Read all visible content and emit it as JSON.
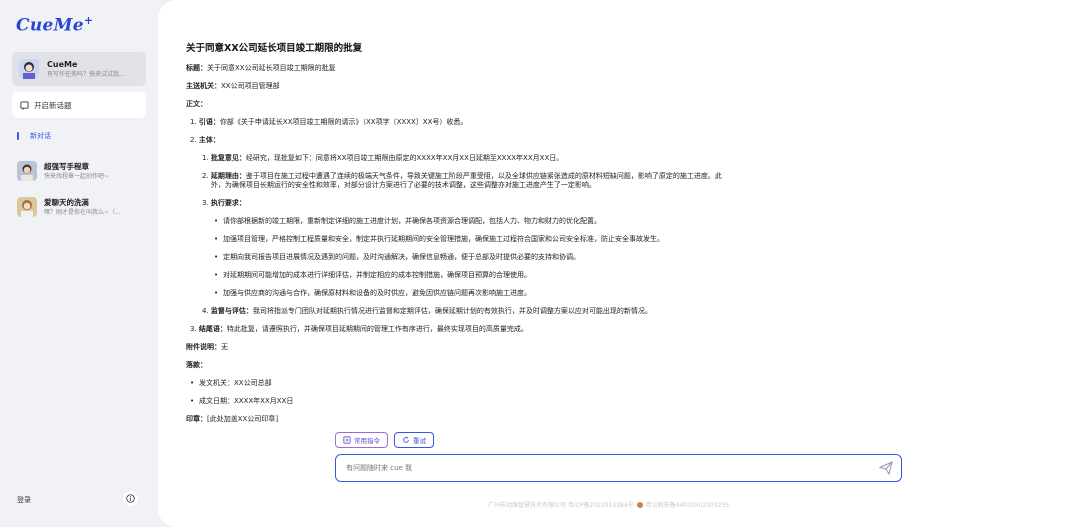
{
  "sidebar": {
    "logo": "CueMe",
    "logo_plus": "+",
    "bot": {
      "name": "CueMe",
      "subtitle": "有写作任务吗？快来试试我..."
    },
    "new_chat_label": "开启新话题",
    "active_conversation": "新对话",
    "conversations": [
      {
        "title": "超强写手程章",
        "subtitle": "快来找程章一起创作吧~"
      },
      {
        "title": "爱聊天的洗滴",
        "subtitle": "嘿？刚才是你在叫我么~（..."
      }
    ],
    "login_label": "登录"
  },
  "document": {
    "title": "关于同意XX公司延长项目竣工期限的批复",
    "lines": {
      "l1_label": "标题：",
      "l1_text": "关于同意XX公司延长项目竣工期限的批复",
      "l2_label": "主送机关：",
      "l2_text": "XX公司项目管理部",
      "l3_label": "正文：",
      "l4_num": "1.",
      "l4_label": "引语：",
      "l4_text": "你部《关于申请延长XX项目竣工期限的请示》（XX项字〔XXXX〕XX号）收悉。",
      "l5_num": "2.",
      "l5_label": "主体：",
      "l6_num": "1.",
      "l6_label": "批复意见：",
      "l6_text": "经研究，现批复如下：同意将XX项目竣工期限由原定的XXXX年XX月XX日延期至XXXX年XX月XX日。",
      "l7_num": "2.",
      "l7_label": "延期理由：",
      "l7_text": "鉴于项目在施工过程中遭遇了连续的极端天气条件，导致关键施工阶段严重受阻，以及全球供应链紧张造成的原材料短缺问题，影响了原定的施工进度。此外，为确保项目长期运行的安全性和效率，对部分设计方案进行了必要的技术调整，这些调整亦对施工进度产生了一定影响。",
      "l8_num": "3.",
      "l8_label": "执行要求：",
      "b1": "请你部根据新的竣工期限，重新制定详细的施工进度计划，并确保各项资源合理调配，包括人力、物力和财力的优化配置。",
      "b2": "加强项目管理，严格控制工程质量和安全，制定并执行延期期间的安全管理措施，确保施工过程符合国家和公司安全标准，防止安全事故发生。",
      "b3": "定期向我司报告项目进展情况及遇到的问题，及时沟通解决，确保信息畅通，便于总部及时提供必要的支持和协调。",
      "b4": "对延期期间可能增加的成本进行详细评估，并制定相应的成本控制措施，确保项目预算的合理使用。",
      "b5": "加强与供应商的沟通与合作，确保原材料和设备的及时供应，避免因供应链问题再次影响施工进度。",
      "l9_num": "4.",
      "l9_label": "监督与评估：",
      "l9_text": "我司将指派专门团队对延期执行情况进行监督和定期评估，确保延期计划的有效执行，并及时调整方案以应对可能出现的新情况。",
      "l10_num": "3.",
      "l10_label": "结尾语：",
      "l10_text": "特此批复，请遵照执行，并确保项目延期期间的管理工作有序进行，最终实现项目的高质量完成。",
      "l11_label": "附件说明：",
      "l11_text": "无",
      "l12_label": "落款：",
      "b6": "发文机关：XX公司总部",
      "b7": "成文日期：XXXX年XX月XX日",
      "l13_label": "印章：",
      "l13_text": "[此处加盖XX公司印章]"
    }
  },
  "toolbar": {
    "common_cmd_label": "常用指令",
    "retry_label": "重试"
  },
  "input": {
    "placeholder": "有问题随时来 cue 我"
  },
  "footer": {
    "icp": "广州市动维智慧技术有限公司 粤ICP备2022013384号",
    "police": "粤公网安备44010502003255"
  },
  "colors": {
    "accent": "#3a55e0",
    "sidebar_bg": "#f1f2f6",
    "page_bg": "#ffffff"
  }
}
